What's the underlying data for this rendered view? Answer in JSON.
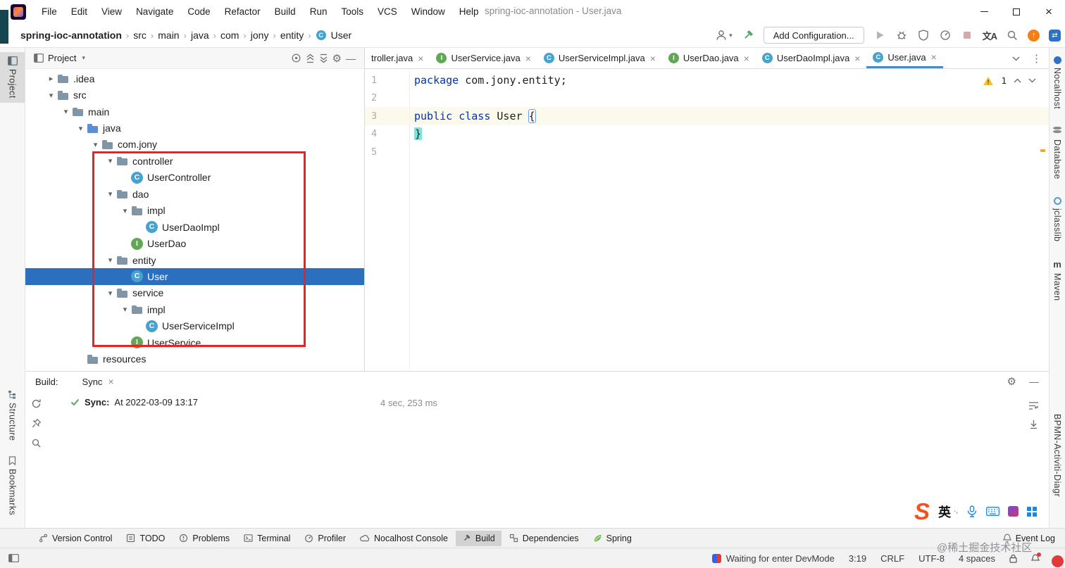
{
  "colors": {
    "selection_blue": "#2b6fbf",
    "annotation_red": "#ec2222",
    "keyword_blue": "#0033b3",
    "caret_line_yellow": "#fcfaed",
    "class_icon_blue": "#46a3cf",
    "interface_icon_green": "#61a854",
    "update_orange": "#f57f17"
  },
  "titlebar": {
    "title": "spring-ioc-annotation - User.java",
    "menus": [
      "File",
      "Edit",
      "View",
      "Navigate",
      "Code",
      "Refactor",
      "Build",
      "Run",
      "Tools",
      "VCS",
      "Window",
      "Help"
    ]
  },
  "navbar": {
    "breadcrumbs": [
      "spring-ioc-annotation",
      "src",
      "main",
      "java",
      "com",
      "jony",
      "entity",
      "User"
    ],
    "add_configuration_label": "Add Configuration...",
    "translate_label": "文A",
    "icons": [
      "user-icon",
      "hammer-icon",
      "run-icon",
      "debug-icon",
      "coverage-icon",
      "profiler-icon",
      "stop-icon",
      "translate-icon",
      "search-icon",
      "update-icon",
      "nocalhost-icon"
    ]
  },
  "left_strip": {
    "project_label": "Project",
    "structure_label": "Structure",
    "bookmarks_label": "Bookmarks"
  },
  "right_strip": {
    "items": [
      "Nocalhost",
      "Database",
      "jclasslib",
      "Maven"
    ],
    "bottom_label": "BPMN-Activiti-Diagr"
  },
  "project_panel": {
    "title": "Project",
    "tree": [
      {
        "label": ".idea",
        "depth": 0,
        "icon": "folder-icon",
        "chevron": "right",
        "selected": false
      },
      {
        "label": "src",
        "depth": 0,
        "icon": "folder-icon",
        "chevron": "down",
        "selected": false
      },
      {
        "label": "main",
        "depth": 1,
        "icon": "folder-icon",
        "chevron": "down",
        "selected": false
      },
      {
        "label": "java",
        "depth": 2,
        "icon": "source-folder-icon",
        "chevron": "down",
        "selected": false
      },
      {
        "label": "com.jony",
        "depth": 3,
        "icon": "package-icon",
        "chevron": "down",
        "selected": false
      },
      {
        "label": "controller",
        "depth": 4,
        "icon": "package-icon",
        "chevron": "down",
        "selected": false
      },
      {
        "label": "UserController",
        "depth": 5,
        "icon": "class-icon",
        "chevron": "none",
        "selected": false
      },
      {
        "label": "dao",
        "depth": 4,
        "icon": "package-icon",
        "chevron": "down",
        "selected": false
      },
      {
        "label": "impl",
        "depth": 5,
        "icon": "package-icon",
        "chevron": "down",
        "selected": false
      },
      {
        "label": "UserDaoImpl",
        "depth": 6,
        "icon": "class-icon",
        "chevron": "none",
        "selected": false
      },
      {
        "label": "UserDao",
        "depth": 5,
        "icon": "interface-icon",
        "chevron": "none",
        "selected": false
      },
      {
        "label": "entity",
        "depth": 4,
        "icon": "package-icon",
        "chevron": "down",
        "selected": false
      },
      {
        "label": "User",
        "depth": 5,
        "icon": "class-icon",
        "chevron": "none",
        "selected": true
      },
      {
        "label": "service",
        "depth": 4,
        "icon": "package-icon",
        "chevron": "down",
        "selected": false
      },
      {
        "label": "impl",
        "depth": 5,
        "icon": "package-icon",
        "chevron": "down",
        "selected": false
      },
      {
        "label": "UserServiceImpl",
        "depth": 6,
        "icon": "class-icon",
        "chevron": "none",
        "selected": false
      },
      {
        "label": "UserService",
        "depth": 5,
        "icon": "interface-icon",
        "chevron": "none",
        "selected": false
      },
      {
        "label": "resources",
        "depth": 2,
        "icon": "folder-icon",
        "chevron": "none",
        "selected": false
      }
    ]
  },
  "editor": {
    "tabs": [
      {
        "label": "troller.java",
        "icon": "none",
        "active": false
      },
      {
        "label": "UserService.java",
        "icon": "interface-icon",
        "active": false
      },
      {
        "label": "UserServiceImpl.java",
        "icon": "class-icon",
        "active": false
      },
      {
        "label": "UserDao.java",
        "icon": "interface-icon",
        "active": false
      },
      {
        "label": "UserDaoImpl.java",
        "icon": "class-icon",
        "active": false
      },
      {
        "label": "User.java",
        "icon": "class-icon",
        "active": true
      }
    ],
    "warning_count": "1",
    "line_numbers": [
      "1",
      "2",
      "3",
      "4",
      "5"
    ],
    "code": {
      "line1_keyword": "package",
      "line1_rest": " com.jony.entity;",
      "line3_keyword": "public class",
      "line3_name": " User ",
      "line3_brace": "{",
      "line4_brace": "}"
    }
  },
  "build_panel": {
    "label": "Build:",
    "tab_label": "Sync",
    "sync_title": "Sync:",
    "sync_text": "At 2022-03-09 13:17",
    "duration": "4 sec, 253 ms"
  },
  "bottom_bar": {
    "items": [
      "Version Control",
      "TODO",
      "Problems",
      "Terminal",
      "Profiler",
      "Nocalhost Console",
      "Build",
      "Dependencies",
      "Spring"
    ],
    "active_item": "Build",
    "event_log_label": "Event Log"
  },
  "status_bar": {
    "devmode_text": "Waiting for enter DevMode",
    "caret_position": "3:19",
    "line_separator": "CRLF",
    "encoding": "UTF-8",
    "indent": "4 spaces"
  },
  "ime": {
    "logo_letter": "S",
    "lang_label": "英"
  },
  "watermark": "@稀土掘金技术社区"
}
